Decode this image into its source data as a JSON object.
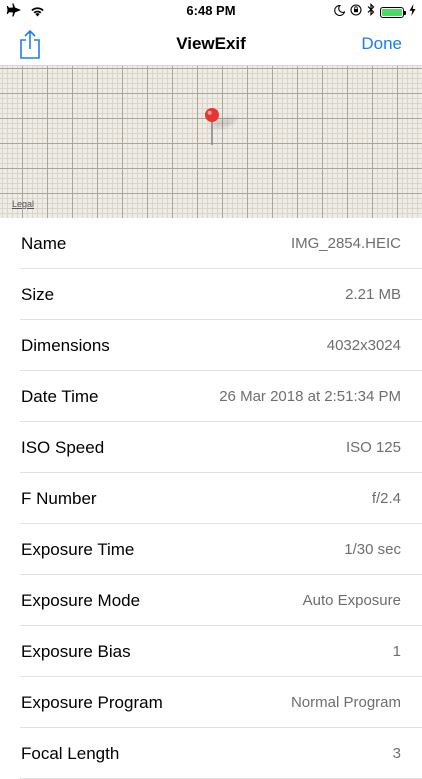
{
  "status_bar": {
    "time": "6:48 PM",
    "battery_level": 1.0,
    "battery_color": "#4cd964"
  },
  "nav": {
    "title": "ViewExif",
    "done_label": "Done",
    "share_icon": "share-icon",
    "accent_color": "#1a7ef2"
  },
  "map": {
    "legal_label": "Legal",
    "pin_color": "#e8352f"
  },
  "rows": [
    {
      "label": "Name",
      "value": "IMG_2854.HEIC"
    },
    {
      "label": "Size",
      "value": "2.21 MB"
    },
    {
      "label": "Dimensions",
      "value": "4032x3024"
    },
    {
      "label": "Date Time",
      "value": "26 Mar 2018 at 2:51:34 PM"
    },
    {
      "label": "ISO Speed",
      "value": "ISO 125"
    },
    {
      "label": "F Number",
      "value": "f/2.4"
    },
    {
      "label": "Exposure Time",
      "value": "1/30 sec"
    },
    {
      "label": "Exposure Mode",
      "value": "Auto Exposure"
    },
    {
      "label": "Exposure Bias",
      "value": "1"
    },
    {
      "label": "Exposure Program",
      "value": "Normal Program"
    },
    {
      "label": "Focal Length",
      "value": "3"
    }
  ]
}
